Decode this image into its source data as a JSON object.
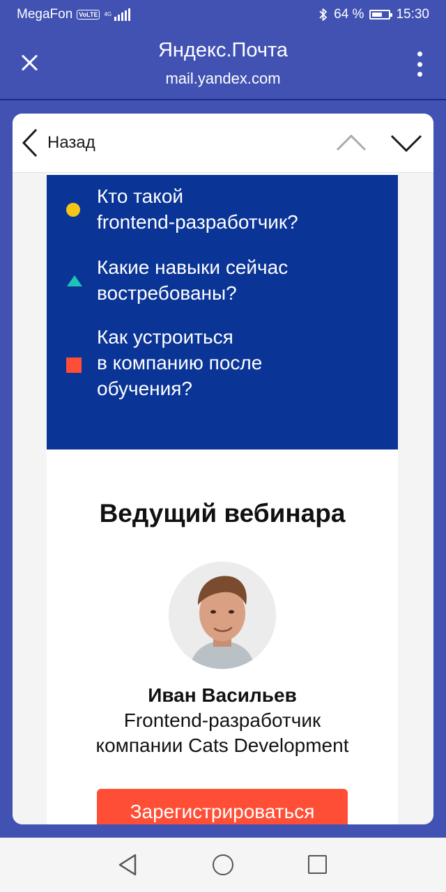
{
  "status_bar": {
    "carrier": "MegaFon",
    "volte": "VoLTE",
    "network": "4G",
    "battery_percent": "64 %",
    "battery_level": 0.64,
    "time": "15:30"
  },
  "app_bar": {
    "title": "Яндекс.Почта",
    "url": "mail.yandex.com"
  },
  "nav": {
    "back_label": "Назад"
  },
  "email": {
    "questions": [
      {
        "text": "Кто такой\nfrontend-разработчик?",
        "bullet": "circle",
        "color": "#f5c518"
      },
      {
        "text": "Какие навыки сейчас\nвостребованы?",
        "bullet": "triangle",
        "color": "#20c3b8"
      },
      {
        "text": "Как устроиться\nв компанию после\nобучения?",
        "bullet": "square",
        "color": "#ff4e36"
      }
    ],
    "host_heading": "Ведущий вебинара",
    "host_name": "Иван Васильев",
    "host_role": "Frontend-разработчик\nкомпании Cats Development",
    "register_label": "Зарегистрироваться"
  },
  "colors": {
    "app_bar": "#4152b3",
    "block": "#0a3496",
    "accent": "#ff4e36"
  }
}
